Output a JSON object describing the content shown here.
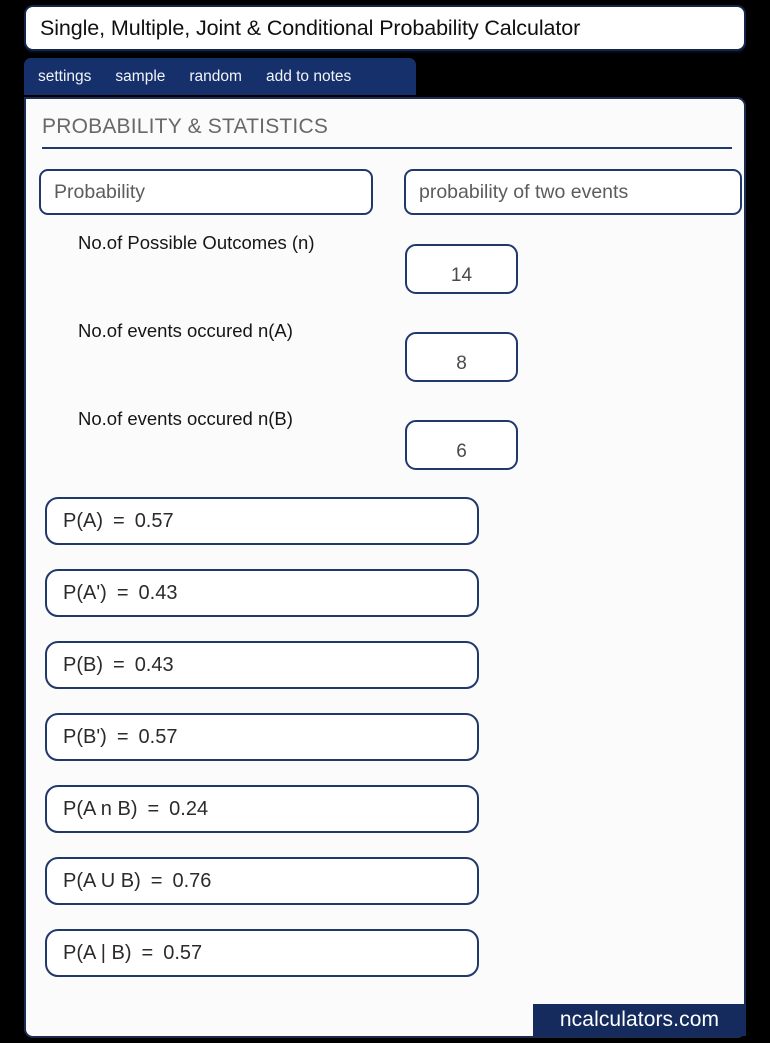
{
  "window": {
    "title": "Single, Multiple, Joint & Conditional Probability Calculator"
  },
  "tabs": [
    {
      "label": "settings"
    },
    {
      "label": "sample"
    },
    {
      "label": "random"
    },
    {
      "label": "add to notes"
    }
  ],
  "card": {
    "section_heading": "PROBABILITY & STATISTICS"
  },
  "selectors": {
    "calculator_type": "Probability",
    "calculation_mode": "probability of two events"
  },
  "inputs": [
    {
      "label": "No.of Possible Outcomes (n)",
      "value": "14"
    },
    {
      "label": "No.of events occured n(A)",
      "value": "8"
    },
    {
      "label": "No.of events occured n(B)",
      "value": "6"
    }
  ],
  "results": [
    {
      "label": "P(A)",
      "eq": "=",
      "value": "0.57"
    },
    {
      "label": "P(A')",
      "eq": "=",
      "value": "0.43"
    },
    {
      "label": "P(B)",
      "eq": "=",
      "value": "0.43"
    },
    {
      "label": "P(B')",
      "eq": "=",
      "value": "0.57"
    },
    {
      "label": "P(A n B)",
      "eq": "=",
      "value": "0.24"
    },
    {
      "label": "P(A U B)",
      "eq": "=",
      "value": "0.76"
    },
    {
      "label": "P(A | B)",
      "eq": "=",
      "value": "0.57"
    }
  ],
  "footer": {
    "brand": "ncalculators.com"
  },
  "colors": {
    "navy": "#16306b",
    "border_navy": "#22376a",
    "card_bg": "#fbfbfb",
    "page_bg": "#000000",
    "heading_gray": "#686868"
  }
}
